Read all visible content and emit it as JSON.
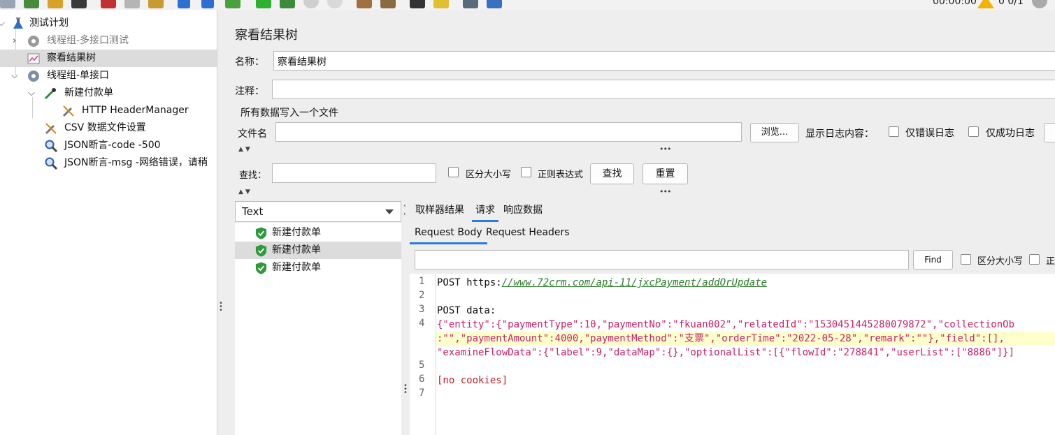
{
  "toolbar": {
    "timer": "00:00:00",
    "counts": "0  0/1"
  },
  "tree": {
    "items": [
      {
        "label": "测试计划"
      },
      {
        "label": "线程组-多接口测试"
      },
      {
        "label": "察看结果树"
      },
      {
        "label": "线程组-单接口"
      },
      {
        "label": "新建付款单"
      },
      {
        "label": "HTTP HeaderManager"
      },
      {
        "label": "CSV 数据文件设置"
      },
      {
        "label": "JSON断言-code -500"
      },
      {
        "label": "JSON断言-msg -网络错误，请稍"
      }
    ]
  },
  "panel": {
    "title": "察看结果树",
    "name_label": "名称：",
    "name_value": "察看结果树",
    "comment_label": "注释：",
    "comment_value": "",
    "group_label": "所有数据写入一个文件",
    "filename_label": "文件名",
    "filename_value": "",
    "browse_label": "浏览...",
    "show_log_label": "显示日志内容：",
    "errors_only_label": "仅错误日志",
    "success_only_label": "仅成功日志"
  },
  "search": {
    "label": "查找：",
    "value": "",
    "case_label": "区分大小写",
    "regex_label": "正则表达式",
    "find_label": "查找",
    "reset_label": "重置"
  },
  "results": {
    "renderer": "Text",
    "samples": [
      "新建付款单",
      "新建付款单",
      "新建付款单"
    ]
  },
  "detail": {
    "tabs": [
      "取样器结果",
      "请求",
      "响应数据"
    ],
    "subtabs": [
      "Request Body",
      "Request Headers"
    ],
    "find_label": "Find",
    "find_case_label": "区分大小写",
    "find_regex_label": "正",
    "lines": {
      "l1_prefix": "POST https:",
      "l1_url": "//www.72crm.com/api-11/jxcPayment/addOrUpdate",
      "l3": "POST data:",
      "l4": "{\"entity\":{\"paymentType\":10,\"paymentNo\":\"fkuan002\",\"relatedId\":\"1530451445280079872\",\"collectionOb",
      "l4b": ":\"\",\"paymentAmount\":4000,\"paymentMethod\":\"支票\",\"orderTime\":\"2022-05-28\",\"remark\":\"\"},\"field\":[],",
      "l4c": "\"examineFlowData\":{\"label\":9,\"dataMap\":{},\"optionalList\":[{\"flowId\":\"278841\",\"userList\":[\"8886\"]}]",
      "l6": "[no cookies]"
    },
    "line_numbers": [
      "1",
      "2",
      "3",
      "4",
      "5",
      "6",
      "7"
    ]
  },
  "colors": {
    "accent": "#2e7bd6",
    "shield_green": "#2e9b3a",
    "json_key": "#c4236a",
    "url_green": "#2b7d2b"
  }
}
